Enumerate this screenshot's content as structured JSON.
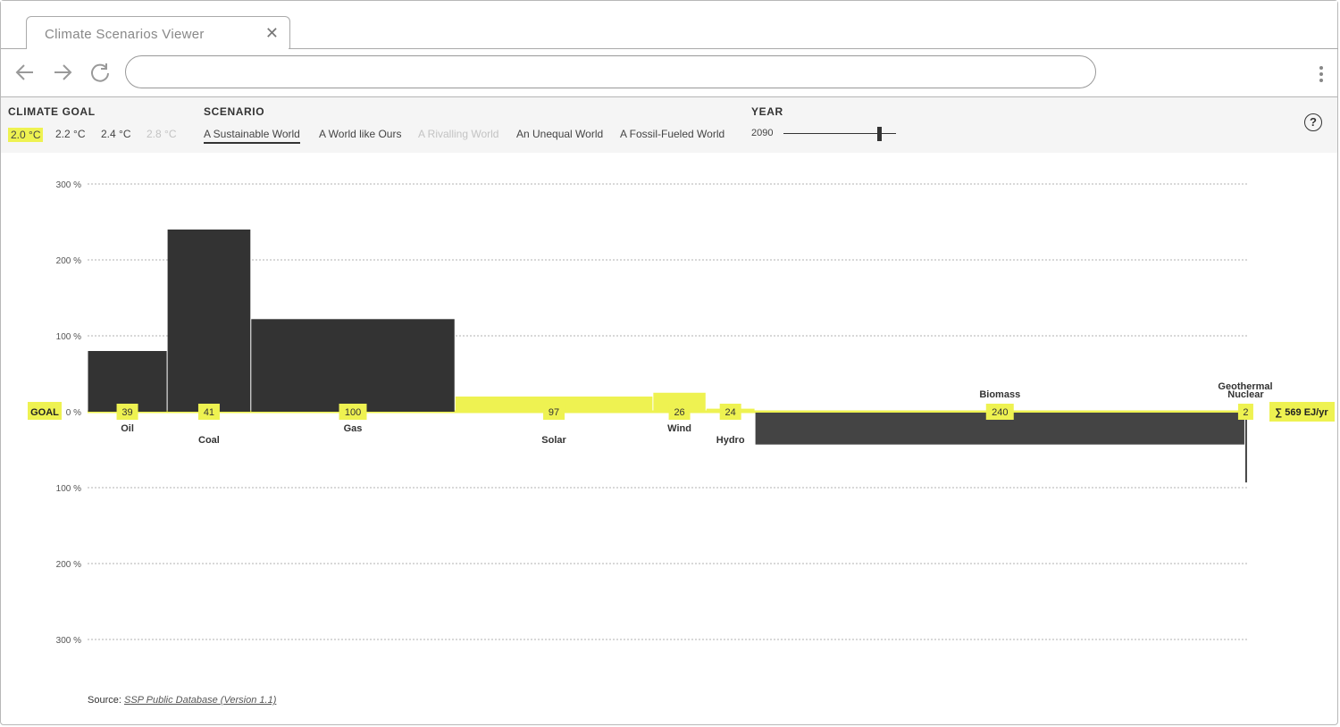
{
  "browser": {
    "tab_title": "Climate Scenarios Viewer",
    "address_value": ""
  },
  "controls": {
    "climate_goal": {
      "heading": "CLIMATE GOAL",
      "options": [
        "2.0 °C",
        "2.2 °C",
        "2.4 °C",
        "2.8 °C"
      ],
      "selected": "2.0 °C",
      "disabled": [
        "2.8 °C"
      ]
    },
    "scenario": {
      "heading": "SCENARIO",
      "options": [
        "A Sustainable World",
        "A World like Ours",
        "A Rivalling World",
        "An Unequal World",
        "A Fossil-Fueled World"
      ],
      "selected": "A Sustainable World",
      "disabled": [
        "A Rivalling World"
      ]
    },
    "year": {
      "heading": "YEAR",
      "value": "2090",
      "slider_position_fraction": 0.86
    },
    "help_label": "?"
  },
  "chart_data": {
    "type": "bar",
    "subtype": "variable-width deviation chart",
    "y_ticks_above": [
      "300 %",
      "200 %",
      "100 %"
    ],
    "y_tick_zero": "0 %",
    "y_ticks_below": [
      "100 %",
      "200 %",
      "300 %"
    ],
    "ylim": [
      -300,
      300
    ],
    "goal_label": "GOAL",
    "total_label": "∑ 569 EJ/yr",
    "categories": [
      "Oil",
      "Coal",
      "Gas",
      "Solar",
      "Wind",
      "Hydro",
      "Biomass",
      "Nuclear",
      "Geothermal"
    ],
    "values_ej": [
      39,
      41,
      100,
      97,
      26,
      24,
      240,
      2,
      0
    ],
    "value_labels": [
      "39",
      "41",
      "100",
      "97",
      "26",
      "24",
      "240",
      "2",
      ""
    ],
    "deviation_percent": [
      80,
      240,
      122,
      20,
      25,
      4,
      -42,
      -92,
      0
    ],
    "colors": {
      "fossil": "#333333",
      "renewable_up": "#eef251",
      "renewable_down": "#444444",
      "goal": "#eef251",
      "grid": "#999999"
    },
    "grid": true
  },
  "source": {
    "prefix": "Source:",
    "link_text": "SSP Public Database (Version 1.1)"
  }
}
